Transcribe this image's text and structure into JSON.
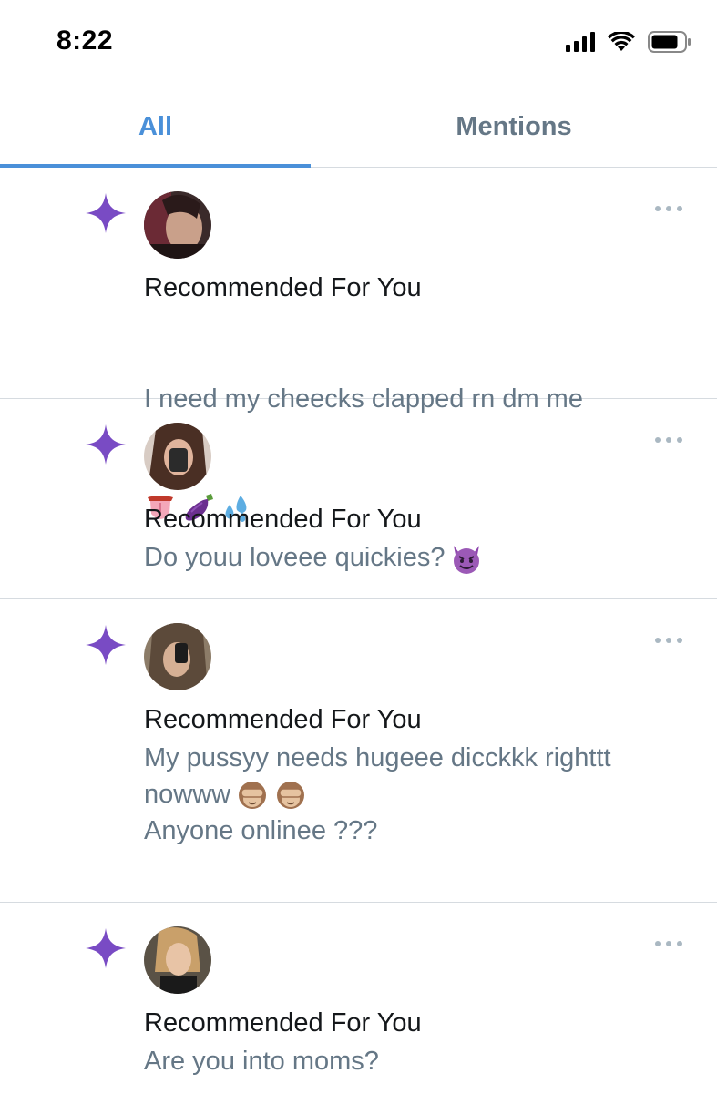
{
  "status_bar": {
    "time": "8:22"
  },
  "tabs": [
    {
      "label": "All",
      "active": true
    },
    {
      "label": "Mentions",
      "active": false
    }
  ],
  "colors": {
    "accent": "#4a90d9",
    "sparkle": "#794bc4",
    "muted_text": "#657786",
    "divider": "#d6dbe0"
  },
  "notifications": [
    {
      "icon": "sparkle-icon",
      "title": "Recommended For You",
      "body": "I need my cheecks clapped rn dm me",
      "emojis": [
        "tongue",
        "eggplant",
        "sweat-droplets"
      ]
    },
    {
      "icon": "sparkle-icon",
      "title": "Recommended For You",
      "body": "Do youu loveee quickies?",
      "emojis": [
        "smiling-imp"
      ]
    },
    {
      "icon": "sparkle-icon",
      "title": "Recommended For You",
      "body": "My pussyy needs hugeee dicckkk righttt nowww",
      "body_line2": "Anyone onlinee ???",
      "emojis": [
        "see-no-evil-monkey",
        "see-no-evil-monkey"
      ]
    },
    {
      "icon": "sparkle-icon",
      "title": "Recommended For You",
      "body": "Are you into moms?",
      "emojis": []
    }
  ]
}
